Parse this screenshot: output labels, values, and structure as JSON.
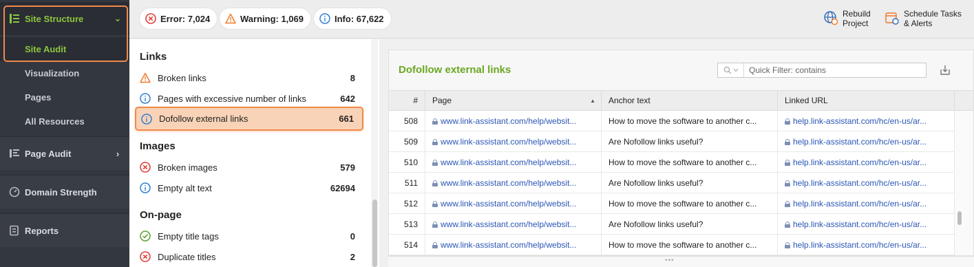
{
  "sidebar": {
    "site_structure": {
      "label": "Site Structure",
      "icon": "tree-structure-icon"
    },
    "sub_items": [
      {
        "label": "Site Audit",
        "active": true
      },
      {
        "label": "Visualization"
      },
      {
        "label": "Pages"
      },
      {
        "label": "All Resources"
      }
    ],
    "sections": [
      {
        "label": "Page Audit",
        "icon": "page-audit-icon"
      },
      {
        "label": "Domain Strength",
        "icon": "gauge-icon"
      },
      {
        "label": "Reports",
        "icon": "reports-icon"
      }
    ]
  },
  "topbar": {
    "error": "Error: 7,024",
    "warning": "Warning: 1,069",
    "info": "Info: 67,622",
    "rebuild_l1": "Rebuild",
    "rebuild_l2": "Project",
    "schedule_l1": "Schedule Tasks",
    "schedule_l2": "& Alerts"
  },
  "issues": {
    "groups": {
      "links": "Links",
      "images": "Images",
      "onpage": "On-page"
    },
    "rows": [
      {
        "label": "Broken links",
        "count": "8",
        "type": "warning"
      },
      {
        "label": "Pages with excessive number of links",
        "count": "642",
        "type": "info"
      },
      {
        "label": "Dofollow external links",
        "count": "661",
        "type": "info",
        "selected": true
      },
      {
        "label": "Broken images",
        "count": "579",
        "type": "error"
      },
      {
        "label": "Empty alt text",
        "count": "62694",
        "type": "info"
      },
      {
        "label": "Empty title tags",
        "count": "0",
        "type": "ok"
      },
      {
        "label": "Duplicate titles",
        "count": "2",
        "type": "error"
      }
    ]
  },
  "detail": {
    "title": "Dofollow external links",
    "quick_filter_placeholder": "Quick Filter: contains",
    "columns": [
      "#",
      "Page",
      "Anchor text",
      "Linked URL"
    ],
    "rows": [
      {
        "num": "508",
        "page": "www.link-assistant.com/help/websit...",
        "anchor": "How to move the software to another c...",
        "url": "help.link-assistant.com/hc/en-us/ar..."
      },
      {
        "num": "509",
        "page": "www.link-assistant.com/help/websit...",
        "anchor": "Are Nofollow links useful?",
        "url": "help.link-assistant.com/hc/en-us/ar..."
      },
      {
        "num": "510",
        "page": "www.link-assistant.com/help/websit...",
        "anchor": "How to move the software to another c...",
        "url": "help.link-assistant.com/hc/en-us/ar..."
      },
      {
        "num": "511",
        "page": "www.link-assistant.com/help/websit...",
        "anchor": "Are Nofollow links useful?",
        "url": "help.link-assistant.com/hc/en-us/ar..."
      },
      {
        "num": "512",
        "page": "www.link-assistant.com/help/websit...",
        "anchor": "How to move the software to another c...",
        "url": "help.link-assistant.com/hc/en-us/ar..."
      },
      {
        "num": "513",
        "page": "www.link-assistant.com/help/websit...",
        "anchor": "Are Nofollow links useful?",
        "url": "help.link-assistant.com/hc/en-us/ar..."
      },
      {
        "num": "514",
        "page": "www.link-assistant.com/help/websit...",
        "anchor": "How to move the software to another c...",
        "url": "help.link-assistant.com/hc/en-us/ar..."
      }
    ]
  },
  "colors": {
    "accent_green": "#8cc63f",
    "highlight_orange": "#f08a4b",
    "link_blue": "#2a56b5",
    "error_red": "#e0403a",
    "warning_orange": "#f07a2a",
    "info_blue": "#2f7fd3"
  }
}
